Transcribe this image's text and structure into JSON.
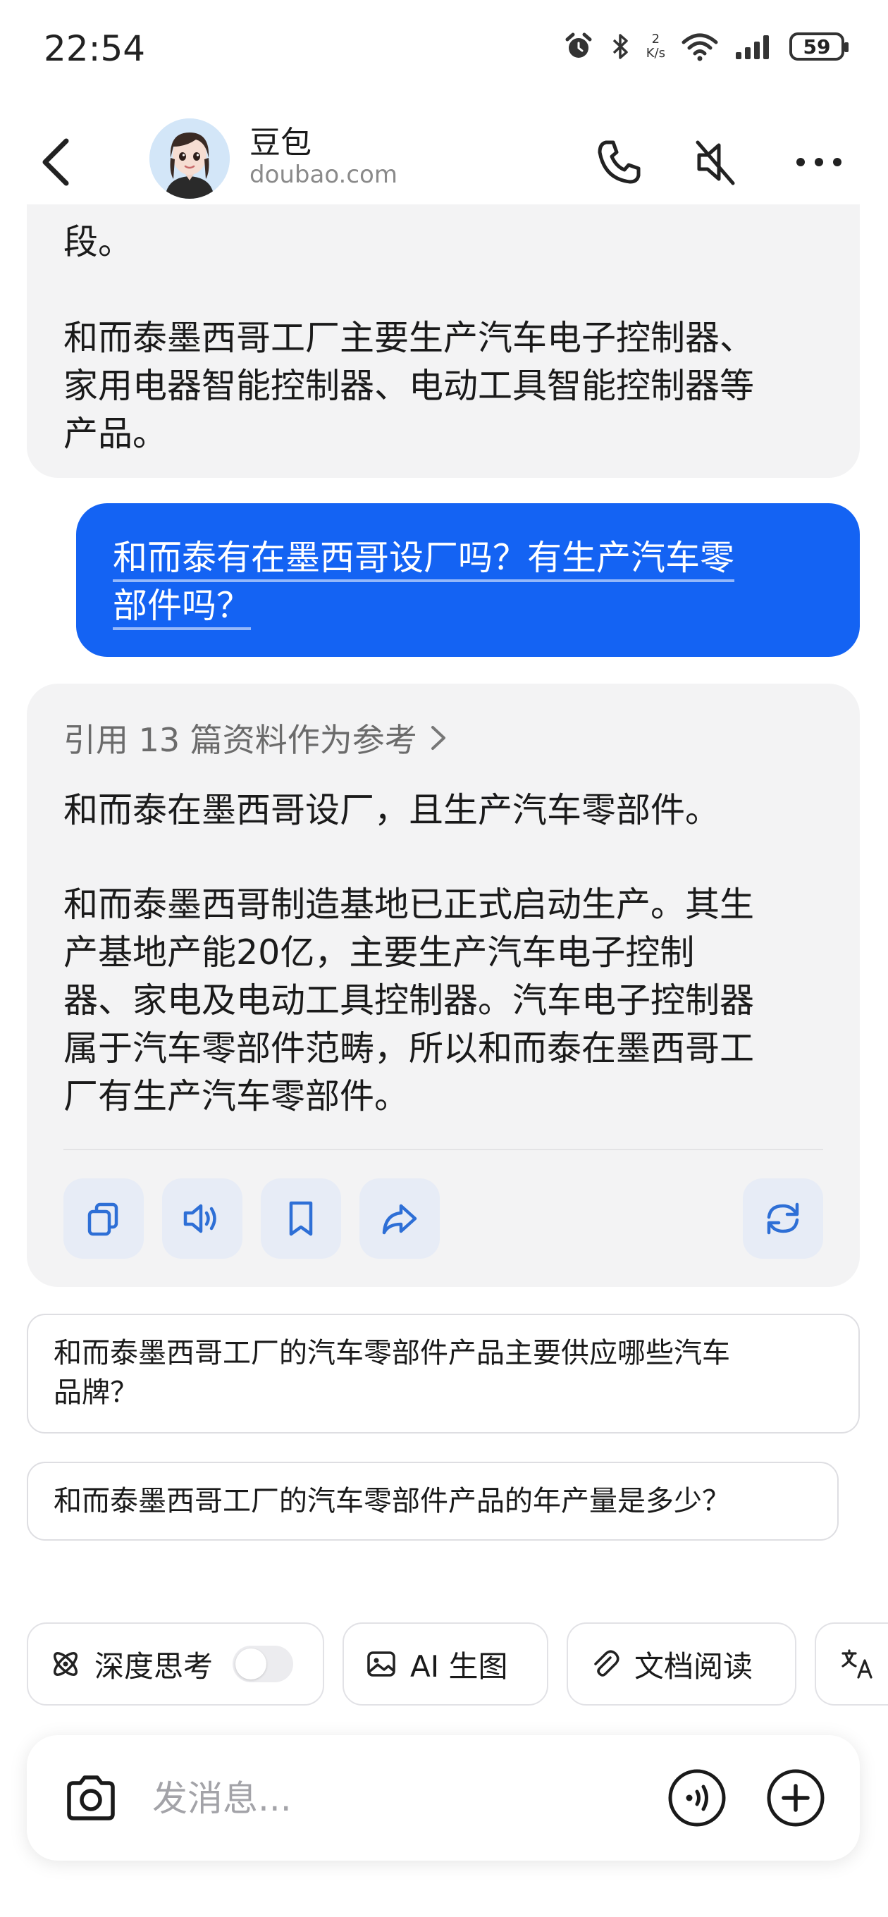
{
  "status_bar": {
    "time": "22:54",
    "net_speed_value": "2",
    "net_speed_unit": "K/s",
    "battery": "59"
  },
  "header": {
    "name": "豆包",
    "domain": "doubao.com"
  },
  "messages": {
    "ai_prev": {
      "fragment": "段。",
      "paragraph": "和而泰墨西哥工厂主要生产汽车电子控制器、\n家用电器智能控制器、电动工具智能控制器等\n产品。"
    },
    "user": {
      "line1": "和而泰有在墨西哥设厂吗？有生产汽车零",
      "line2": "部件吗？"
    },
    "ai_reply": {
      "reference_link": "引用 13 篇资料作为参考",
      "summary": "和而泰在墨西哥设厂，且生产汽车零部件。",
      "detail": "和而泰墨西哥制造基地已正式启动生产。其生\n产基地产能20亿，主要生产汽车电子控制\n器、家电及电动工具控制器。汽车电子控制器\n属于汽车零部件范畴，所以和而泰在墨西哥工\n厂有生产汽车零部件。"
    }
  },
  "suggestions": [
    "和而泰墨西哥工厂的汽车零部件产品主要供应哪些汽车\n品牌？",
    "和而泰墨西哥工厂的汽车零部件产品的年产量是多少？"
  ],
  "tools": {
    "deep_think": "深度思考",
    "ai_image": "AI 生图",
    "doc_read": "文档阅读"
  },
  "input": {
    "placeholder": "发消息..."
  },
  "colors": {
    "accent": "#1463f3",
    "bubble_grey": "#f3f3f4",
    "action_bg": "#e7ecf6",
    "action_icon": "#2e6fd6"
  }
}
